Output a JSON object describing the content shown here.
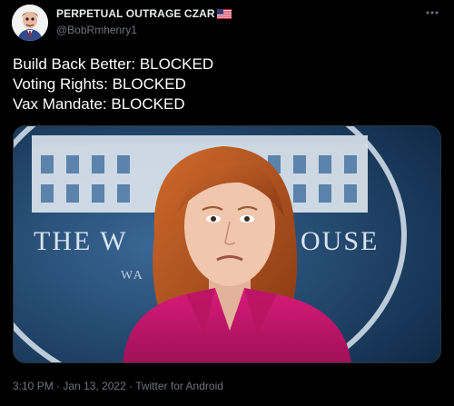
{
  "tweet": {
    "display_name": "PERPETUAL OUTRAGE CZAR",
    "handle": "@BobRmhenry1",
    "more_icon": "more-options-icon",
    "lines": [
      "Build Back Better: BLOCKED",
      "Voting Rights: BLOCKED",
      "Vax Mandate: BLOCKED"
    ],
    "media": {
      "sign_text_left": "THE W",
      "sign_text_right": "OUSE",
      "sign_text_small": "WA"
    },
    "timestamp": "3:10 PM · Jan 13, 2022 · ",
    "source": "Twitter for Android"
  },
  "colors": {
    "background": "#000000",
    "text": "#ffffff",
    "secondary": "#71767b",
    "jacket": "#c2186b",
    "hair": "#b9541f",
    "backdrop": "#1b3d62"
  }
}
